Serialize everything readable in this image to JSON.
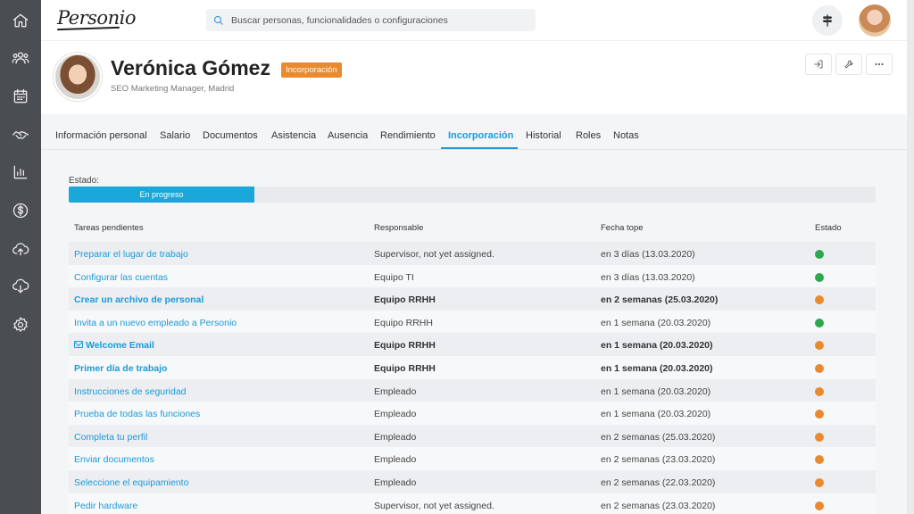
{
  "app": {
    "logo_text": "Personio"
  },
  "search": {
    "placeholder": "Buscar personas, funcionalidades o configuraciones"
  },
  "sidebar": {
    "items": [
      {
        "icon": "home-icon"
      },
      {
        "icon": "people-icon"
      },
      {
        "icon": "calendar-icon"
      },
      {
        "icon": "handshake-icon"
      },
      {
        "icon": "bar-chart-icon"
      },
      {
        "icon": "dollar-icon"
      },
      {
        "icon": "cloud-upload-icon"
      },
      {
        "icon": "cloud-download-icon"
      },
      {
        "icon": "settings-icon"
      }
    ]
  },
  "profile": {
    "name": "Verónica Gómez",
    "badge": "Incorporación",
    "subtitle": "SEO Marketing Manager, Madrid"
  },
  "tabs": [
    {
      "label": "Información personal"
    },
    {
      "label": "Salario"
    },
    {
      "label": "Documentos"
    },
    {
      "label": "Asistencia"
    },
    {
      "label": "Ausencia"
    },
    {
      "label": "Rendimiento"
    },
    {
      "label": "Incorporación",
      "active": true
    },
    {
      "label": "Historial"
    },
    {
      "label": "Roles"
    },
    {
      "label": "Notas"
    }
  ],
  "status": {
    "label": "Estado:",
    "progress_label": "En progreso",
    "progress_fraction": 0.23
  },
  "table": {
    "headers": [
      "Tareas pendientes",
      "Responsable",
      "Fecha tope",
      "Estado"
    ],
    "rows": [
      {
        "task": "Preparar el lugar de trabajo",
        "owner": "Supervisor, not yet assigned.",
        "due": "en 3 días (13.03.2020)",
        "status": "green",
        "bold": false
      },
      {
        "task": "Configurar las cuentas",
        "owner": "Equipo TI",
        "due": "en 3 días (13.03.2020)",
        "status": "green",
        "bold": false
      },
      {
        "task": "Crear un archivo de personal",
        "owner": "Equipo RRHH",
        "due": "en 2 semanas (25.03.2020)",
        "status": "orange",
        "bold": true
      },
      {
        "task": "Invita a un nuevo empleado a Personio",
        "owner": "Equipo RRHH",
        "due": "en 1 semana (20.03.2020)",
        "status": "green",
        "bold": false
      },
      {
        "task": "Welcome Email",
        "owner": "Equipo RRHH",
        "due": "en 1 semana (20.03.2020)",
        "status": "orange",
        "bold": true,
        "icon": "mail-icon"
      },
      {
        "task": "Primer día de trabajo",
        "owner": "Equipo RRHH",
        "due": "en 1 semana (20.03.2020)",
        "status": "orange",
        "bold": true
      },
      {
        "task": "Instrucciones de seguridad",
        "owner": "Empleado",
        "due": "en 1 semana (20.03.2020)",
        "status": "orange",
        "bold": false
      },
      {
        "task": "Prueba de todas las funciones",
        "owner": "Empleado",
        "due": "en 1 semana (20.03.2020)",
        "status": "orange",
        "bold": false
      },
      {
        "task": "Completa tu perfil",
        "owner": "Empleado",
        "due": "en 2 semanas (25.03.2020)",
        "status": "orange",
        "bold": false
      },
      {
        "task": "Enviar documentos",
        "owner": "Empleado",
        "due": "en 2 semanas (23.03.2020)",
        "status": "orange",
        "bold": false
      },
      {
        "task": "Seleccione el equipamiento",
        "owner": "Empleado",
        "due": "en 2 semanas (22.03.2020)",
        "status": "orange",
        "bold": false
      },
      {
        "task": "Pedir hardware",
        "owner": "Supervisor, not yet assigned.",
        "due": "en 2 semanas (23.03.2020)",
        "status": "orange",
        "bold": false
      }
    ]
  },
  "colors": {
    "accent": "#1a9bd7",
    "green": "#2ea84f",
    "orange": "#e98a2f",
    "badge": "#e98a2f"
  }
}
